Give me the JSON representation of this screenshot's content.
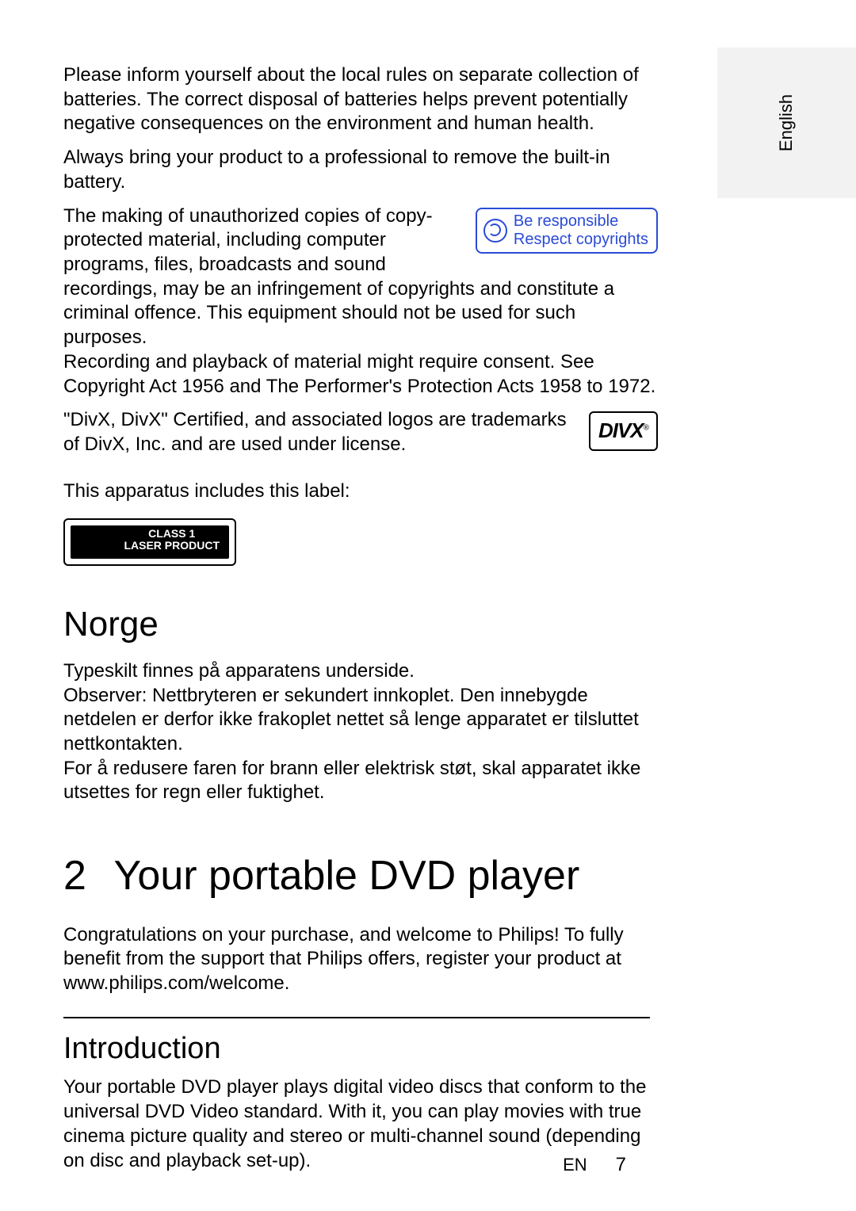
{
  "sidebar": {
    "language": "English"
  },
  "para1": "Please inform yourself about the local rules on separate collection of batteries. The correct disposal of batteries helps prevent potentially negative consequences on the environment and human health.",
  "para2": "Always bring your product to a professional to remove the built-in battery.",
  "copyrightBox": {
    "line1": "Be responsible",
    "line2": "Respect copyrights"
  },
  "para3": "The making of unauthorized copies of copy-protected material, including computer programs, files, broadcasts and sound recordings, may be an infringement of copyrights and constitute a criminal offence. This equipment should not be used for such purposes.",
  "para4": "Recording and playback of material might require consent. See Copyright Act 1956 and The Performer's Protection Acts 1958 to 1972.",
  "divxLogo": "DIVX",
  "para5": "\"DivX, DivX\" Certified, and associated logos are trademarks of DivX, Inc. and are used under license.",
  "labelHeading": "This apparatus includes this label:",
  "laserLabel": {
    "line1": "CLASS 1",
    "line2": "LASER PRODUCT"
  },
  "norge": {
    "heading": "Norge",
    "p1": "Typeskilt finnes på apparatens underside.",
    "p2": "Observer: Nettbryteren er sekundert innkoplet. Den innebygde netdelen er derfor ikke frakoplet nettet så lenge apparatet er tilsluttet nettkontakten.",
    "p3": "For å redusere faren for brann eller elektrisk støt, skal apparatet ikke utsettes for regn eller fuktighet."
  },
  "chapter": {
    "number": "2",
    "title": "Your portable DVD player",
    "intro": "Congratulations on your purchase, and welcome to Philips! To fully benefit from the support that Philips offers, register your product at www.philips.com/welcome."
  },
  "section": {
    "heading": "Introduction",
    "body": "Your portable DVD player plays digital video discs that conform to the universal DVD Video standard. With it, you can play movies with true cinema picture quality and stereo or multi-channel sound (depending on disc and playback set-up)."
  },
  "footer": {
    "lang": "EN",
    "page": "7"
  }
}
